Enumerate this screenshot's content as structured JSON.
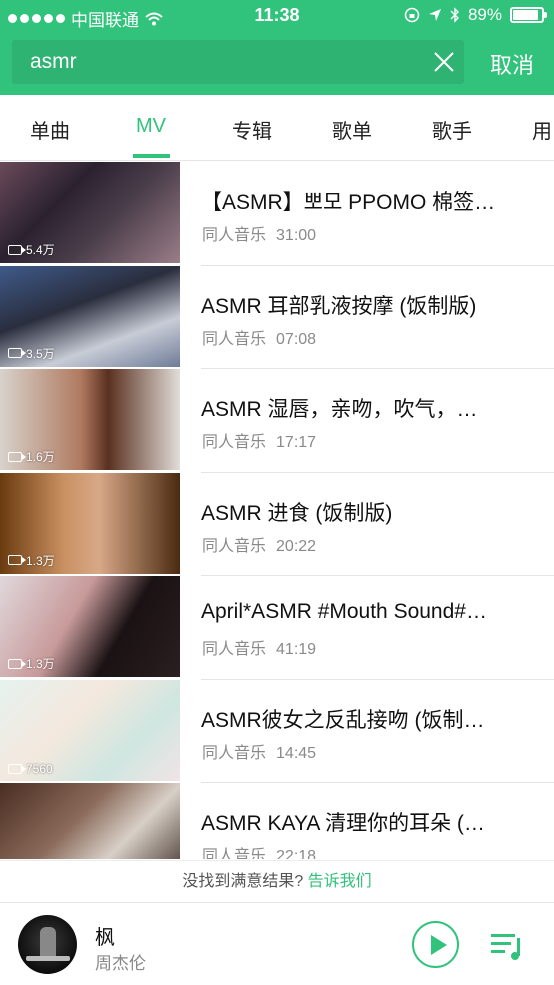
{
  "status_bar": {
    "carrier": "中国联通",
    "time": "11:38",
    "battery": "89%",
    "battery_level": 0.89
  },
  "search": {
    "value": "asmr",
    "placeholder": "",
    "cancel_label": "取消"
  },
  "tabs": [
    {
      "label": "单曲",
      "active": false
    },
    {
      "label": "MV",
      "active": true
    },
    {
      "label": "专辑",
      "active": false
    },
    {
      "label": "歌单",
      "active": false
    },
    {
      "label": "歌手",
      "active": false
    },
    {
      "label": "用",
      "active": false
    }
  ],
  "results": [
    {
      "title": "【ASMR】뽀모 PPOMO 棉签…",
      "source": "同人音乐",
      "duration": "31:00",
      "views": "5.4万"
    },
    {
      "title": "ASMR  耳部乳液按摩 (饭制版)",
      "source": "同人音乐",
      "duration": "07:08",
      "views": "3.5万"
    },
    {
      "title": "ASMR 湿唇，亲吻，吹气，…",
      "source": "同人音乐",
      "duration": "17:17",
      "views": "1.6万"
    },
    {
      "title": "ASMR 进食 (饭制版)",
      "source": "同人音乐",
      "duration": "20:22",
      "views": "1.3万"
    },
    {
      "title": "April*ASMR #Mouth Sound#…",
      "source": "同人音乐",
      "duration": "41:19",
      "views": "1.3万"
    },
    {
      "title": "ASMR彼女之反乱接吻 (饭制…",
      "source": "同人音乐",
      "duration": "14:45",
      "views": "7560"
    },
    {
      "title": "ASMR KAYA 清理你的耳朵 (…",
      "source": "同人音乐",
      "duration": "22:18",
      "views": ""
    }
  ],
  "hint": {
    "text": "没找到满意结果?",
    "link": "告诉我们"
  },
  "player": {
    "song": "枫",
    "artist": "周杰伦"
  },
  "colors": {
    "accent": "#31c27c"
  }
}
